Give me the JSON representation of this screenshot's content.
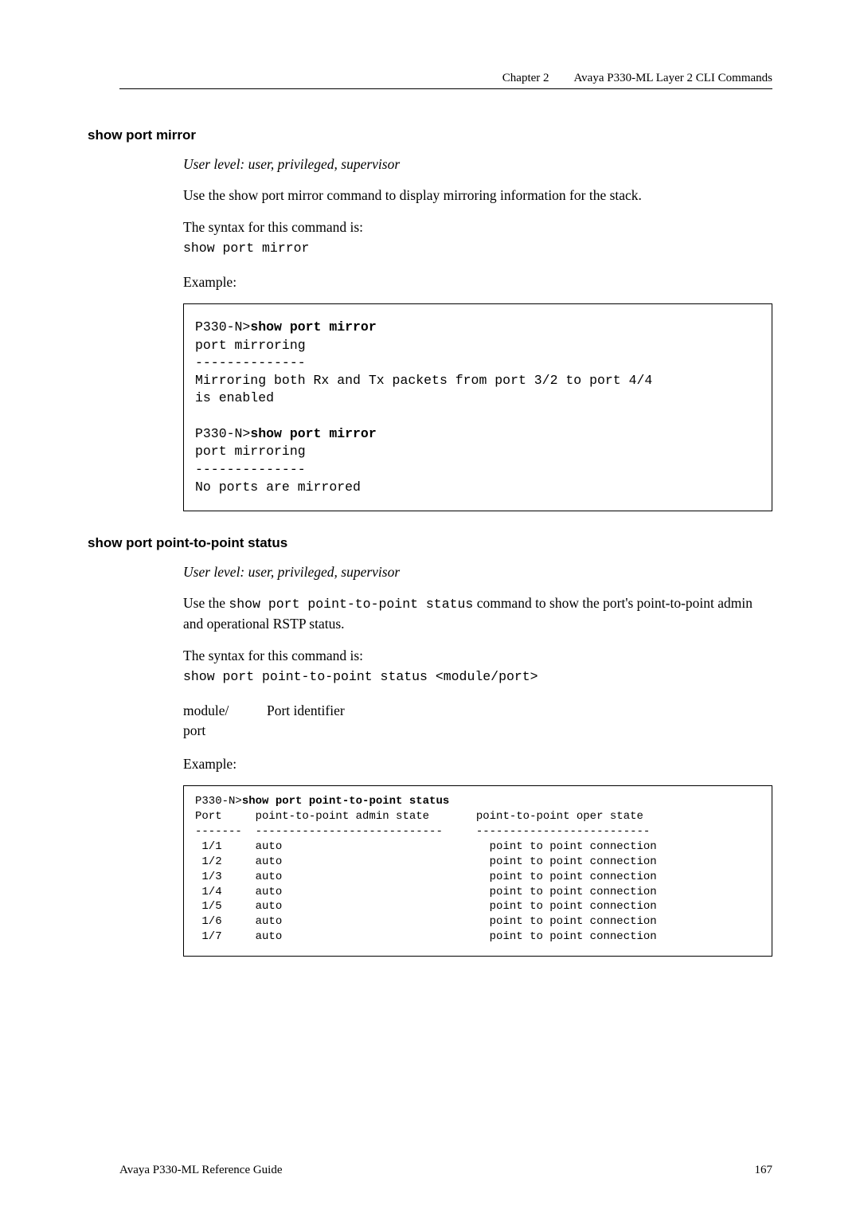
{
  "header": {
    "chapter_label": "Chapter 2",
    "chapter_title": "Avaya P330-ML Layer 2 CLI Commands"
  },
  "section1": {
    "heading": "show port mirror",
    "userlevel": "User level: user, privileged, supervisor",
    "desc": "Use the show port mirror command to display mirroring information for the stack.",
    "syntax_label": "The syntax for this command is:",
    "syntax_code": "show port mirror",
    "example_label": "Example:",
    "codebox": {
      "l1a": "P330-N>",
      "l1b": "show port mirror",
      "l2": "port mirroring",
      "l3": "--------------",
      "l4": "Mirroring both Rx and Tx packets from port 3/2 to port 4/4",
      "l5": "is enabled",
      "l6": "",
      "l7a": "P330-N>",
      "l7b": "show port mirror",
      "l8": "port mirroring",
      "l9": "--------------",
      "l10": "No ports are mirrored"
    }
  },
  "section2": {
    "heading": "show port point-to-point status",
    "userlevel": "User level: user, privileged, supervisor",
    "desc_pre": "Use the ",
    "desc_code": "show port point-to-point status",
    "desc_post": " command to show the port's point-to-point admin and operational RSTP status.",
    "syntax_label": "The syntax for this command is:",
    "syntax_code": "show port point-to-point status <module/port>",
    "def_term1": "module/",
    "def_term2": "port",
    "def_desc": "Port identifier",
    "example_label": "Example:"
  },
  "chart_data": {
    "type": "table",
    "title": "show port point-to-point status",
    "prompt": "P330-N>",
    "columns": [
      "Port",
      "point-to-point admin state",
      "point-to-point oper state"
    ],
    "rows": [
      {
        "port": "1/1",
        "admin": "auto",
        "oper": "point to point connection"
      },
      {
        "port": "1/2",
        "admin": "auto",
        "oper": "point to point connection"
      },
      {
        "port": "1/3",
        "admin": "auto",
        "oper": "point to point connection"
      },
      {
        "port": "1/4",
        "admin": "auto",
        "oper": "point to point connection"
      },
      {
        "port": "1/5",
        "admin": "auto",
        "oper": "point to point connection"
      },
      {
        "port": "1/6",
        "admin": "auto",
        "oper": "point to point connection"
      },
      {
        "port": "1/7",
        "admin": "auto",
        "oper": "point to point connection"
      }
    ],
    "dashes": {
      "col1": "-------",
      "col2": "----------------------------",
      "col3": "--------------------------"
    }
  },
  "footer": {
    "left": "Avaya P330-ML Reference Guide",
    "right": "167"
  }
}
